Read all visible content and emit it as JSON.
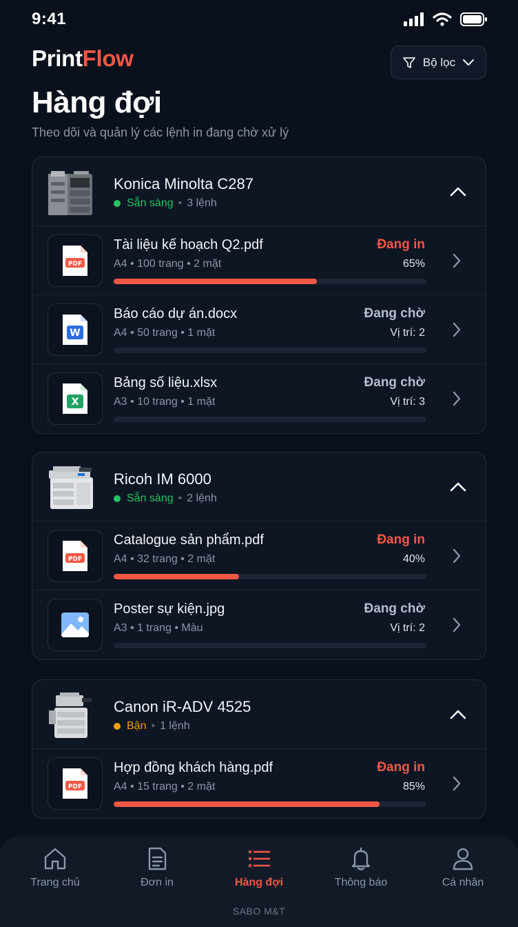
{
  "status_bar": {
    "time": "9:41"
  },
  "header": {
    "logo_part1": "Print",
    "logo_part2": "Flow",
    "filter_label": "Bộ lọc",
    "title": "Hàng đợi",
    "subtitle": "Theo dõi và quản lý các lệnh in đang chờ xử lý"
  },
  "colors": {
    "accent": "#f25846",
    "ready": "#22c55e",
    "busy": "#f59e0b",
    "background": "#0b111c"
  },
  "printers": [
    {
      "name": "Konica Minolta C287",
      "status": "Sẵn sàng",
      "count": "3 lệnh",
      "jobs": [
        {
          "name": "Tài liệu kế hoạch Q2.pdf",
          "meta": "A4 • 100 trang • 2 mặt",
          "status": "Đang in",
          "extra": "65%",
          "icon": "pdf-icon",
          "progress": 0.65
        },
        {
          "name": "Báo cáo dự án.docx",
          "meta": "A4 • 50 trang • 1 mặt",
          "status": "Đang chờ",
          "extra": "Vị trí: 2",
          "icon": "word-icon",
          "progress": 0
        },
        {
          "name": "Bảng số liệu.xlsx",
          "meta": "A3 • 10 trang • 1 mặt",
          "status": "Đang chờ",
          "extra": "Vị trí: 3",
          "icon": "excel-icon",
          "progress": 0
        }
      ]
    },
    {
      "name": "Ricoh IM 6000",
      "status": "Sẵn sàng",
      "count": "2 lệnh",
      "jobs": [
        {
          "name": "Catalogue sản phẩm.pdf",
          "meta": "A4 • 32 trang • 2 mặt",
          "status": "Đang in",
          "extra": "40%",
          "icon": "pdf-icon",
          "progress": 0.4
        },
        {
          "name": "Poster sự kiện.jpg",
          "meta": "A3 • 1 trang • Màu",
          "status": "Đang chờ",
          "extra": "Vị trí: 2",
          "icon": "image-icon",
          "progress": 0
        }
      ]
    },
    {
      "name": "Canon iR-ADV 4525",
      "status": "Bận",
      "count": "1 lệnh",
      "jobs": [
        {
          "name": "Hợp đồng khách hàng.pdf",
          "meta": "A4 • 15 trang • 2 mặt",
          "status": "Đang in",
          "extra": "85%",
          "icon": "pdf-icon",
          "progress": 0.85
        }
      ]
    }
  ],
  "nav": {
    "items": [
      {
        "label": "Trang chủ",
        "icon": "home-icon"
      },
      {
        "label": "Đơn in",
        "icon": "document-icon"
      },
      {
        "label": "Hàng đợi",
        "icon": "queue-list-icon",
        "active": true
      },
      {
        "label": "Thông báo",
        "icon": "bell-icon"
      },
      {
        "label": "Cá nhân",
        "icon": "user-icon"
      }
    ]
  },
  "footer": {
    "brand": "SABO M&T"
  }
}
